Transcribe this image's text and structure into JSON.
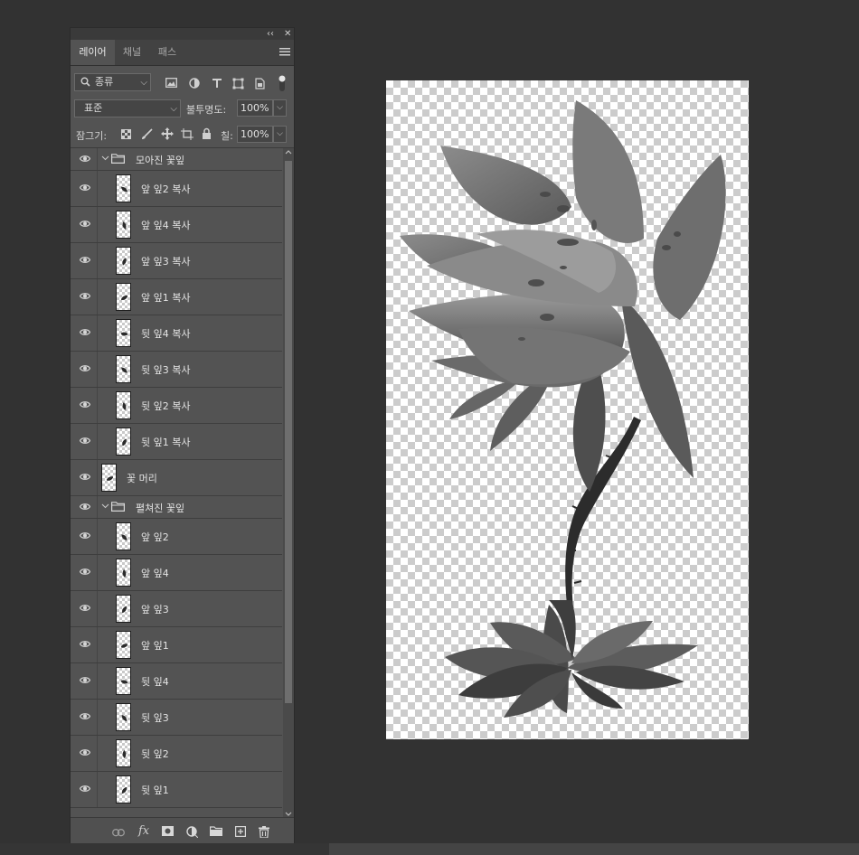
{
  "panel": {
    "collapse_glyph": "‹‹",
    "close_glyph": "✕",
    "tabs": [
      {
        "label": "레이어",
        "active": true
      },
      {
        "label": "채널",
        "active": false
      },
      {
        "label": "패스",
        "active": false
      }
    ],
    "menu_icon": "panel-menu-icon",
    "filter": {
      "kind_label": "종류",
      "icons": [
        "pixel-filter-icon",
        "adjustment-filter-icon",
        "type-filter-icon",
        "shape-filter-icon",
        "smart-object-filter-icon",
        "filter-toggle-icon"
      ]
    },
    "blend": {
      "mode_label": "표준",
      "opacity_label": "불투명도:",
      "opacity_value": "100%"
    },
    "lock": {
      "label": "잠그기:",
      "icons": [
        "lock-transparent-icon",
        "lock-image-icon",
        "lock-position-icon",
        "lock-artboard-icon",
        "lock-all-icon"
      ],
      "fill_label": "칠:",
      "fill_value": "100%"
    },
    "layers": [
      {
        "type": "group",
        "name": "모아진 꽃잎",
        "visible": true,
        "expanded": true
      },
      {
        "type": "layer",
        "name": "앞 잎2 복사",
        "indent": 1,
        "visible": true
      },
      {
        "type": "layer",
        "name": "앞 잎4 복사",
        "indent": 1,
        "visible": true
      },
      {
        "type": "layer",
        "name": "앞 잎3 복사",
        "indent": 1,
        "visible": true
      },
      {
        "type": "layer",
        "name": "앞 잎1 복사",
        "indent": 1,
        "visible": true
      },
      {
        "type": "layer",
        "name": "뒷 잎4 복사",
        "indent": 1,
        "visible": true
      },
      {
        "type": "layer",
        "name": "뒷 잎3 복사",
        "indent": 1,
        "visible": true
      },
      {
        "type": "layer",
        "name": "뒷 잎2 복사",
        "indent": 1,
        "visible": true
      },
      {
        "type": "layer",
        "name": "뒷 잎1 복사",
        "indent": 1,
        "visible": true
      },
      {
        "type": "layer",
        "name": "꽃 머리",
        "indent": 0,
        "visible": true
      },
      {
        "type": "group",
        "name": "펼쳐진 꽃잎",
        "visible": true,
        "expanded": true
      },
      {
        "type": "layer",
        "name": "앞 잎2",
        "indent": 1,
        "visible": true
      },
      {
        "type": "layer",
        "name": "앞 잎4",
        "indent": 1,
        "visible": true
      },
      {
        "type": "layer",
        "name": "앞 잎3",
        "indent": 1,
        "visible": true
      },
      {
        "type": "layer",
        "name": "앞 잎1",
        "indent": 1,
        "visible": true
      },
      {
        "type": "layer",
        "name": "뒷 잎4",
        "indent": 1,
        "visible": true
      },
      {
        "type": "layer",
        "name": "뒷 잎3",
        "indent": 1,
        "visible": true
      },
      {
        "type": "layer",
        "name": "뒷 잎2",
        "indent": 1,
        "visible": true
      },
      {
        "type": "layer",
        "name": "뒷 잎1",
        "indent": 1,
        "visible": true
      }
    ],
    "footer": {
      "fx_label": "fx",
      "icons": [
        "link-layers-icon",
        "add-style-icon",
        "add-mask-icon",
        "new-adjustment-icon",
        "new-group-icon",
        "new-layer-icon",
        "delete-layer-icon"
      ]
    }
  },
  "canvas": {
    "background": "transparent-checkerboard",
    "artwork": "grayscale flower illustration"
  }
}
